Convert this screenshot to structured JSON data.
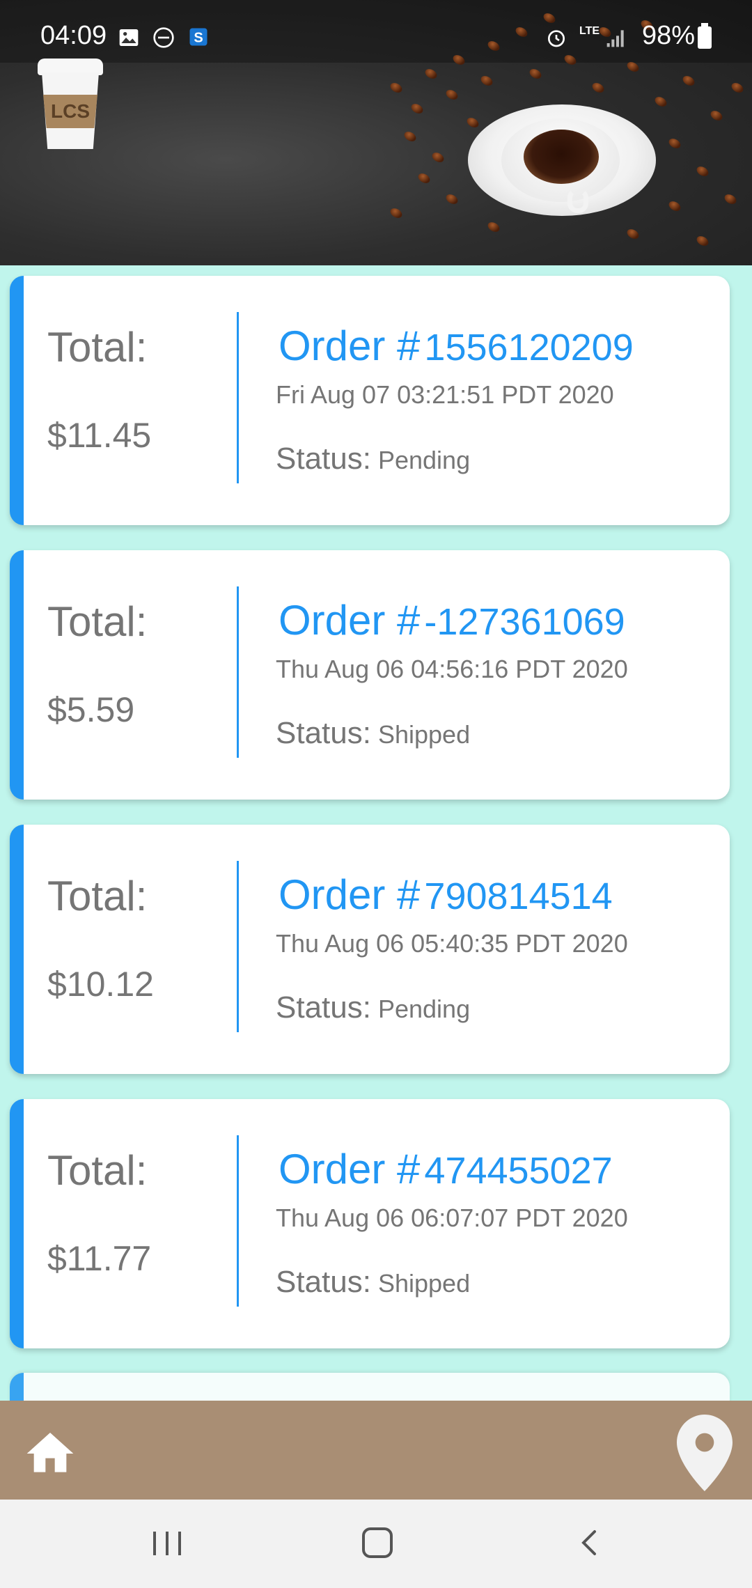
{
  "status_bar": {
    "time": "04:09",
    "network": "LTE",
    "battery": "98%"
  },
  "logo": {
    "text": "LCS"
  },
  "orders": [
    {
      "total_label": "Total:",
      "total": "$11.45",
      "order_label": "Order #",
      "order_number": "1556120209",
      "date": "Fri Aug 07 03:21:51 PDT 2020",
      "status_label": "Status:",
      "status": "Pending"
    },
    {
      "total_label": "Total:",
      "total": "$5.59",
      "order_label": "Order #",
      "order_number": "-127361069",
      "date": "Thu Aug 06 04:56:16 PDT 2020",
      "status_label": "Status:",
      "status": "Shipped"
    },
    {
      "total_label": "Total:",
      "total": "$10.12",
      "order_label": "Order #",
      "order_number": "790814514",
      "date": "Thu Aug 06 05:40:35 PDT 2020",
      "status_label": "Status:",
      "status": "Pending"
    },
    {
      "total_label": "Total:",
      "total": "$11.77",
      "order_label": "Order #",
      "order_number": "474455027",
      "date": "Thu Aug 06 06:07:07 PDT 2020",
      "status_label": "Status:",
      "status": "Shipped"
    }
  ],
  "bottom_bar": {
    "home_icon": "home-icon",
    "location_icon": "location-pin-icon"
  },
  "colors": {
    "accent": "#2196f3",
    "list_background": "#c0f5ec",
    "bottom_bar": "#a98e74"
  }
}
